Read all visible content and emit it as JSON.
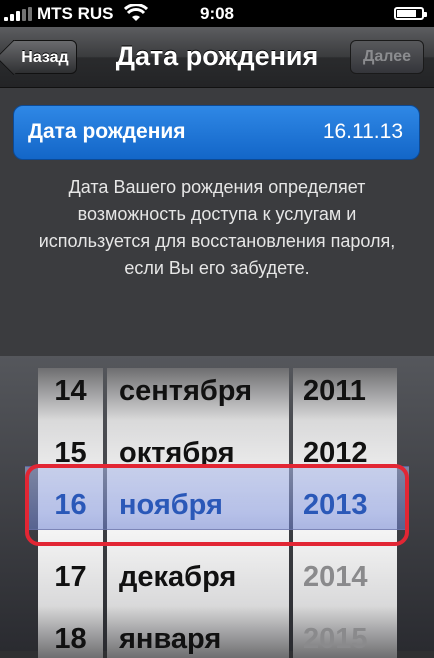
{
  "status": {
    "carrier": "MTS RUS",
    "time": "9:08",
    "battery_level": 0.8
  },
  "nav": {
    "title": "Дата рождения",
    "back_label": "Назад",
    "next_label": "Далее"
  },
  "birth": {
    "label": "Дата рождения",
    "value": "16.11.13"
  },
  "help_text": "Дата Вашего рождения определяет возможность доступа к услугам и используется для восстановления пароля, если Вы его забудете.",
  "picker": {
    "days": [
      "14",
      "15",
      "16",
      "17",
      "18"
    ],
    "months": [
      "сентября",
      "октября",
      "ноября",
      "декабря",
      "января"
    ],
    "years": [
      "2011",
      "2012",
      "2013",
      "2014",
      "2015"
    ],
    "selected_index": 2,
    "max_year_enabled": "2013"
  },
  "colors": {
    "accent": "#1366c8",
    "highlight": "#e22634",
    "selected_text": "#1f4ea8"
  }
}
